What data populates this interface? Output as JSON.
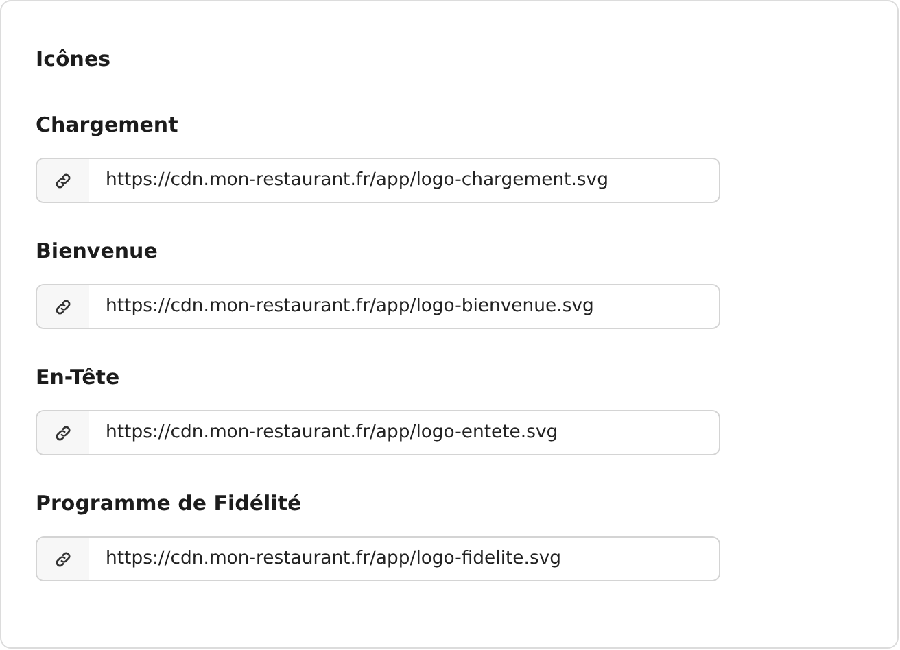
{
  "section": {
    "title": "Icônes"
  },
  "fields": [
    {
      "label": "Chargement",
      "value": "https://cdn.mon-restaurant.fr/app/logo-chargement.svg"
    },
    {
      "label": "Bienvenue",
      "value": "https://cdn.mon-restaurant.fr/app/logo-bienvenue.svg"
    },
    {
      "label": "En-Tête",
      "value": "https://cdn.mon-restaurant.fr/app/logo-entete.svg"
    },
    {
      "label": "Programme de Fidélité",
      "value": "https://cdn.mon-restaurant.fr/app/logo-fidelite.svg"
    }
  ]
}
